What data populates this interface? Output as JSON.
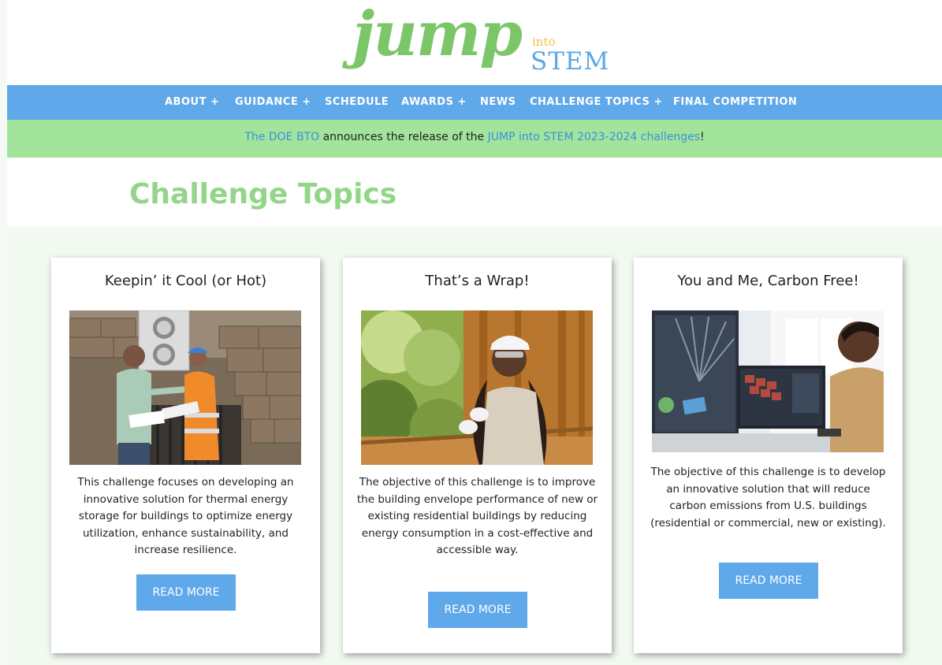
{
  "logo": {
    "jump": "jump",
    "into": "into",
    "stem": "STEM"
  },
  "nav": {
    "items": [
      "ABOUT +",
      "GUIDANCE +",
      "SCHEDULE",
      "AWARDS +",
      "NEWS",
      "CHALLENGE TOPICS +",
      "FINAL COMPETITION"
    ]
  },
  "announcement": {
    "link1": "The DOE BTO",
    "text1": " announces the release of the ",
    "link2": "JUMP into STEM 2023-2024 challenges",
    "text2": "!"
  },
  "page_title": "Challenge Topics",
  "cards": [
    {
      "title": "Keepin’ it Cool (or Hot)",
      "description": "This challenge focuses on developing an innovative solution for thermal energy storage for buildings to optimize energy utilization, enhance sustainability, and increase resilience.",
      "button": "READ MORE"
    },
    {
      "title": "That’s a Wrap!",
      "description": "The objective of this challenge is to improve the building envelope performance of new or existing residential buildings by reducing energy consumption in a cost-effective and accessible way.",
      "button": "READ MORE"
    },
    {
      "title": "You and Me, Carbon Free!",
      "description": "The objective of this challenge is to develop an innovative solution that will reduce carbon emissions from U.S. buildings (residential or commercial, new or existing).",
      "button": "READ MORE"
    }
  ],
  "colors": {
    "nav_blue": "#5fa8ea",
    "announce_green": "#a2e49b",
    "title_green": "#92d688",
    "logo_green": "#7cc66a",
    "logo_yellow": "#f2c14e",
    "logo_blue": "#5aa6e6",
    "link_blue": "#3d8fdc"
  }
}
